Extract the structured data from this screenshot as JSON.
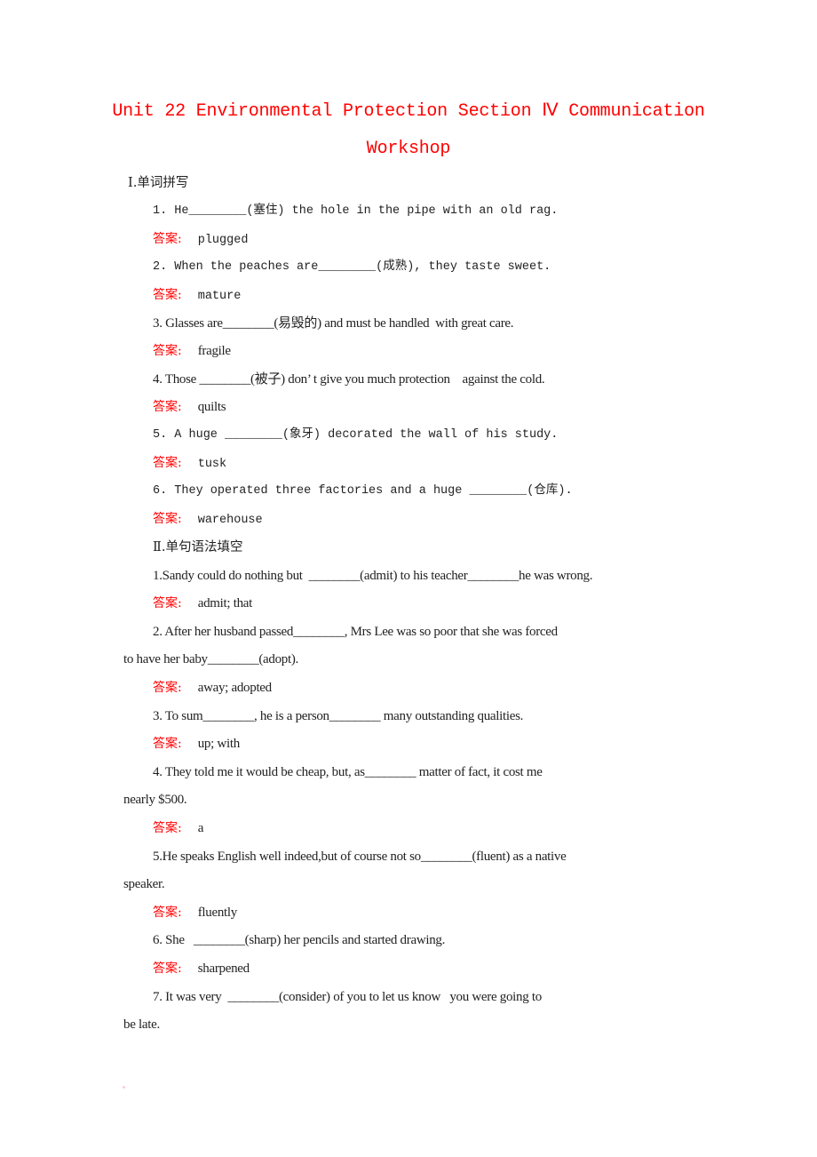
{
  "title": {
    "line1": "Unit 22 Environmental Protection Section Ⅳ Communication",
    "line2": "Workshop"
  },
  "answer_label": "答案:",
  "section1": {
    "heading": "Ⅰ.单词拼写",
    "items": [
      {
        "pre": "1. He",
        "blank": "________",
        "post": "(塞住) the hole in the pipe with an old rag.",
        "answer": "plugged"
      },
      {
        "pre": "2. When the peaches are",
        "blank": "________",
        "post": "(成熟), they taste sweet.",
        "answer": "mature"
      },
      {
        "pre": "3. Glasses are",
        "blank": "________",
        "post": "(易毁的) and must be handled  with great care.",
        "answer": "fragile"
      },
      {
        "pre": "4. Those ",
        "blank": "________",
        "post": "(被子) don’ t give you much protection    against the cold.",
        "answer": "quilts"
      },
      {
        "pre": "5. A huge ",
        "blank": "________",
        "post": "(象牙) decorated the wall of his study.",
        "answer": "tusk"
      },
      {
        "pre": "6. They operated three factories and a huge ",
        "blank": "________",
        "post": "(仓库).",
        "answer": "warehouse"
      }
    ]
  },
  "section2": {
    "heading": "Ⅱ.单句语法填空",
    "items": [
      {
        "line1": "1.Sandy could do nothing but  ________(admit) to his teacher________he was wrong.",
        "line2": "",
        "answer": "admit; that"
      },
      {
        "line1": "2. After her husband passed________, Mrs Lee was so poor that she was forced",
        "line2": "to have her baby________(adopt).",
        "answer": "away; adopted"
      },
      {
        "line1": "3. To sum________, he is a person________ many outstanding qualities.",
        "line2": "",
        "answer": "up; with"
      },
      {
        "line1": "4. They told me it would be cheap, but, as________ matter of fact, it cost me",
        "line2": "nearly $500.",
        "answer": "a"
      },
      {
        "line1": "5.He speaks English well indeed,but of course not so________(fluent) as a native",
        "line2": "speaker.",
        "answer": "fluently"
      },
      {
        "line1": "6. She   ________(sharp) her pencils and started drawing.",
        "line2": "",
        "answer": "sharpened"
      },
      {
        "line1": "7. It was very  ________(consider) of you to let us know   you were going to",
        "line2": "be late.",
        "answer": ""
      }
    ]
  }
}
